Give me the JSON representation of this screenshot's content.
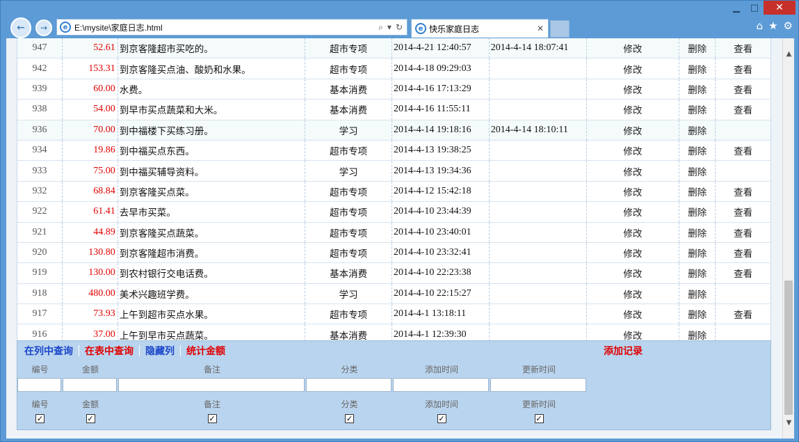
{
  "window": {
    "controls": {
      "minimize": "▁",
      "maximize": "□",
      "close": "✕"
    }
  },
  "browser": {
    "back_icon": "←",
    "forward_icon": "→",
    "address": "E:\\mysite\\家庭日志.html",
    "tab_title": "快乐家庭日志",
    "tab_close": "✕",
    "search_icon": "⌕",
    "dropdown_icon": "▾",
    "refresh_icon": "↻",
    "home_icon": "⌂",
    "favorites_icon": "★",
    "settings_icon": "⚙"
  },
  "table": {
    "edit_label": "修改",
    "delete_label": "删除",
    "view_label": "查看",
    "rows": [
      {
        "id": "947",
        "amount": "52.61",
        "note": "到京客隆超市买吃的。",
        "category": "超市专项",
        "added": "2014-4-21 12:40:57",
        "updated": "2014-4-14 18:07:41",
        "has_view": true,
        "alt": true
      },
      {
        "id": "942",
        "amount": "153.31",
        "note": "到京客隆买点油、酸奶和水果。",
        "category": "超市专项",
        "added": "2014-4-18 09:29:03",
        "updated": "",
        "has_view": true,
        "alt": false
      },
      {
        "id": "939",
        "amount": "60.00",
        "note": "水费。",
        "category": "基本消费",
        "added": "2014-4-16 17:13:29",
        "updated": "",
        "has_view": true,
        "alt": false
      },
      {
        "id": "938",
        "amount": "54.00",
        "note": "到早市买点蔬菜和大米。",
        "category": "基本消费",
        "added": "2014-4-16 11:55:11",
        "updated": "",
        "has_view": true,
        "alt": false
      },
      {
        "id": "936",
        "amount": "70.00",
        "note": "到中福楼下买练习册。",
        "category": "学习",
        "added": "2014-4-14 19:18:16",
        "updated": "2014-4-14 18:10:11",
        "has_view": false,
        "alt": true
      },
      {
        "id": "934",
        "amount": "19.86",
        "note": "到中福买点东西。",
        "category": "超市专项",
        "added": "2014-4-13 19:38:25",
        "updated": "",
        "has_view": true,
        "alt": false
      },
      {
        "id": "933",
        "amount": "75.00",
        "note": "到中福买辅导资料。",
        "category": "学习",
        "added": "2014-4-13 19:34:36",
        "updated": "",
        "has_view": false,
        "alt": false
      },
      {
        "id": "932",
        "amount": "68.84",
        "note": "到京客隆买点菜。",
        "category": "超市专项",
        "added": "2014-4-12 15:42:18",
        "updated": "",
        "has_view": true,
        "alt": false
      },
      {
        "id": "922",
        "amount": "61.41",
        "note": "去早市买菜。",
        "category": "超市专项",
        "added": "2014-4-10 23:44:39",
        "updated": "",
        "has_view": true,
        "alt": false
      },
      {
        "id": "921",
        "amount": "44.89",
        "note": "到京客隆买点蔬菜。",
        "category": "超市专项",
        "added": "2014-4-10 23:40:01",
        "updated": "",
        "has_view": true,
        "alt": false
      },
      {
        "id": "920",
        "amount": "130.80",
        "note": "到京客隆超市消费。",
        "category": "超市专项",
        "added": "2014-4-10 23:32:41",
        "updated": "",
        "has_view": true,
        "alt": false
      },
      {
        "id": "919",
        "amount": "130.00",
        "note": "到农村银行交电话费。",
        "category": "基本消费",
        "added": "2014-4-10 22:23:38",
        "updated": "",
        "has_view": true,
        "alt": false
      },
      {
        "id": "918",
        "amount": "480.00",
        "note": "美术兴趣班学费。",
        "category": "学习",
        "added": "2014-4-10 22:15:27",
        "updated": "",
        "has_view": false,
        "alt": false
      },
      {
        "id": "917",
        "amount": "73.93",
        "note": "上午到超市买点水果。",
        "category": "超市专项",
        "added": "2014-4-1 13:18:11",
        "updated": "",
        "has_view": true,
        "alt": false
      },
      {
        "id": "916",
        "amount": "37.00",
        "note": "上午到早市买点蔬菜。",
        "category": "基本消费",
        "added": "2014-4-1 12:39:30",
        "updated": "",
        "has_view": false,
        "alt": false
      }
    ]
  },
  "panel": {
    "search_in_column": "在列中查询",
    "search_in_table": "在表中查询",
    "hide_columns": "隐藏列",
    "sum_amount": "统计金额",
    "add_record": "添加记录",
    "labels": {
      "id": "编号",
      "amount": "金额",
      "note": "备注",
      "category": "分类",
      "added": "添加时间",
      "updated": "更新时间"
    },
    "check_mark": "✓",
    "colors": {
      "blue_link": "#1a46c9",
      "red_link": "#e00000"
    }
  }
}
